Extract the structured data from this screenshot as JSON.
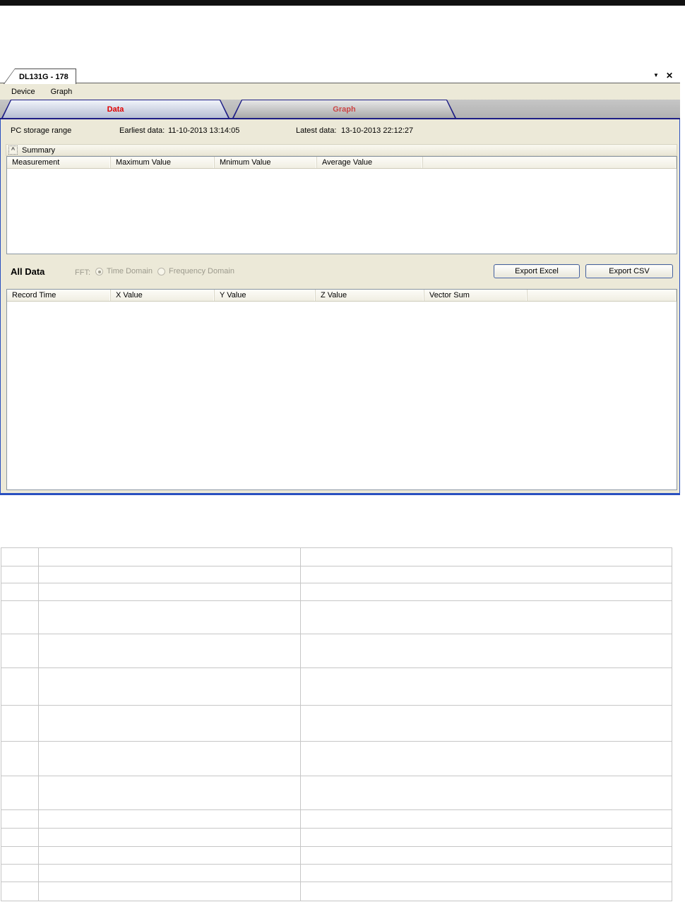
{
  "window": {
    "title": "DL131G - 178",
    "controls": {
      "menu_icon": "▼",
      "close_icon": "✕"
    },
    "menu": [
      "Device",
      "Graph"
    ],
    "tabs": [
      {
        "label": "Data",
        "active": true
      },
      {
        "label": "Graph",
        "active": false
      }
    ],
    "info": {
      "storage_label": "PC storage range",
      "earliest_label": "Earliest data:",
      "earliest_value": "11-10-2013 13:14:05",
      "latest_label": "Latest data:",
      "latest_value": "13-10-2013 22:12:27"
    },
    "summary": {
      "toggle_icon": "^",
      "label": "Summary",
      "columns": [
        "Measurement",
        "Maximum Value",
        "Mnimum Value",
        "Average Value"
      ]
    },
    "all_data": {
      "label": "All Data",
      "fft_label": "FFT:",
      "radios": [
        {
          "label": "Time Domain",
          "selected": true,
          "enabled": false
        },
        {
          "label": "Frequency Domain",
          "selected": false,
          "enabled": false
        }
      ],
      "buttons": [
        "Export Excel",
        "Export CSV"
      ],
      "columns": [
        "Record Time",
        "X Value",
        "Y Value",
        "Z Value",
        "Vector Sum"
      ]
    }
  },
  "colors": {
    "window_bg": "#ece9d8",
    "tab_border_navy": "#1d1d85",
    "active_tab_text_red": "#e00000",
    "inactive_tab_text_red": "#cc4646",
    "window_frame_blue": "#2a50c0",
    "grid_line_gray": "#c6c6c6"
  },
  "document_table": {
    "row_count": 14,
    "column_count": 3,
    "cells_empty": true
  }
}
